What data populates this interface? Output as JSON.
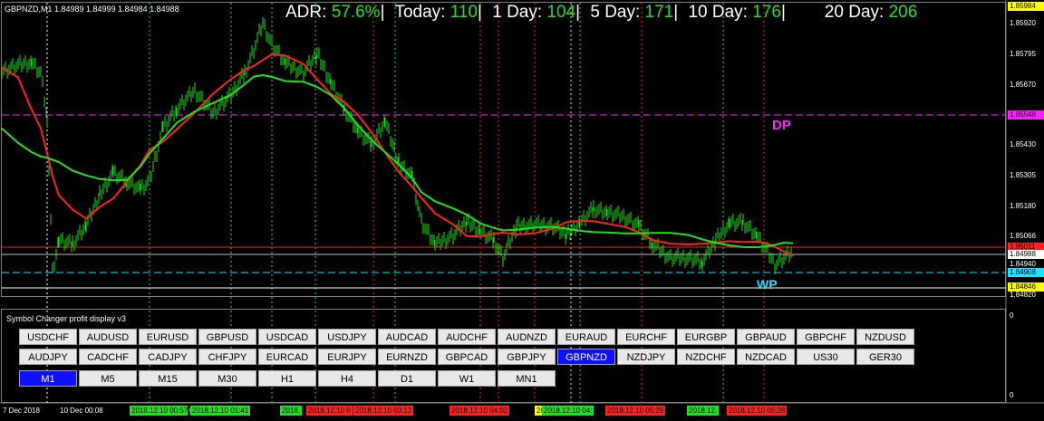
{
  "chart_title": "GBPNZD,M1  1.84989 1.84999 1.84984 1.84988",
  "header": {
    "adr_label": "ADR:",
    "adr_value": "57.6%",
    "today_label": "Today:",
    "today_value": "110",
    "d1_label": "1 Day:",
    "d1_value": "104",
    "d5_label": "5 Day:",
    "d5_value": "171",
    "d10_label": "10 Day:",
    "d10_value": "176",
    "d20_label": "20 Day:",
    "d20_value": "206",
    "bar": "|"
  },
  "markers": {
    "dp": "DP",
    "wp": "WP"
  },
  "price_axis": [
    "1.85920",
    "1.85795",
    "1.85670",
    "1.85430",
    "1.85305",
    "1.85180",
    "1.85066",
    "1.84820"
  ],
  "price_labels": {
    "top": "1.85984",
    "dp": "1.85548",
    "cur_red": "1.85011",
    "cur_white": "1.84988",
    "cur_mid": "1.84940",
    "wp": "1.84908",
    "low": "1.84846"
  },
  "colors": {
    "up": "#20e020",
    "red": "#ff2020",
    "dp": "#ff20ff",
    "wp": "#20e0ff",
    "yellow": "#ffff00"
  },
  "subwindow": {
    "title": "Symbol Changer profit display v3",
    "axis": [
      "0",
      "0"
    ],
    "row1": [
      "USDCHF",
      "AUDUSD",
      "EURUSD",
      "GBPUSD",
      "USDCAD",
      "USDJPY",
      "AUDCAD",
      "AUDCHF",
      "AUDNZD",
      "EURAUD",
      "EURCHF",
      "EURGBP",
      "GBPAUD",
      "GBPCHF",
      "NZDUSD"
    ],
    "row2": [
      "AUDJPY",
      "CADCHF",
      "CADJPY",
      "CHFJPY",
      "EURCAD",
      "EURJPY",
      "EURNZD",
      "GBPCAD",
      "GBPJPY",
      "GBPNZD",
      "NZDJPY",
      "NZDCHF",
      "NZDCAD",
      "US30",
      "GER30"
    ],
    "row3": [
      "M1",
      "M5",
      "M15",
      "M30",
      "H1",
      "H4",
      "D1",
      "W1",
      "MN1"
    ]
  },
  "time_axis": {
    "start": "7 Dec 2018",
    "second": "10 Dec 00:08",
    "boxes": [
      {
        "text": "2018.12.10 00:57",
        "color": "#20e020"
      },
      {
        "text": "01:4",
        "color": "#000000"
      },
      {
        "text": "2018.12.10 01:41",
        "color": "#20e020"
      },
      {
        "text": "2018.",
        "color": "#20e020"
      },
      {
        "text": "2018.12.10 0",
        "color": "#ff2020"
      },
      {
        "text": "2018.12.10 03:12",
        "color": "#ff2020"
      },
      {
        "text": "2018.12.10 04:02",
        "color": "#ff2020"
      },
      {
        "text": "20",
        "color": "#ffff00"
      },
      {
        "text": "2018.12.10 04:",
        "color": "#20e020"
      },
      {
        "text": "2018.12.10 05:29",
        "color": "#ff2020"
      },
      {
        "text": "2018.12.",
        "color": "#20e020"
      },
      {
        "text": "2018.12.10 06:28",
        "color": "#ff2020"
      }
    ]
  }
}
